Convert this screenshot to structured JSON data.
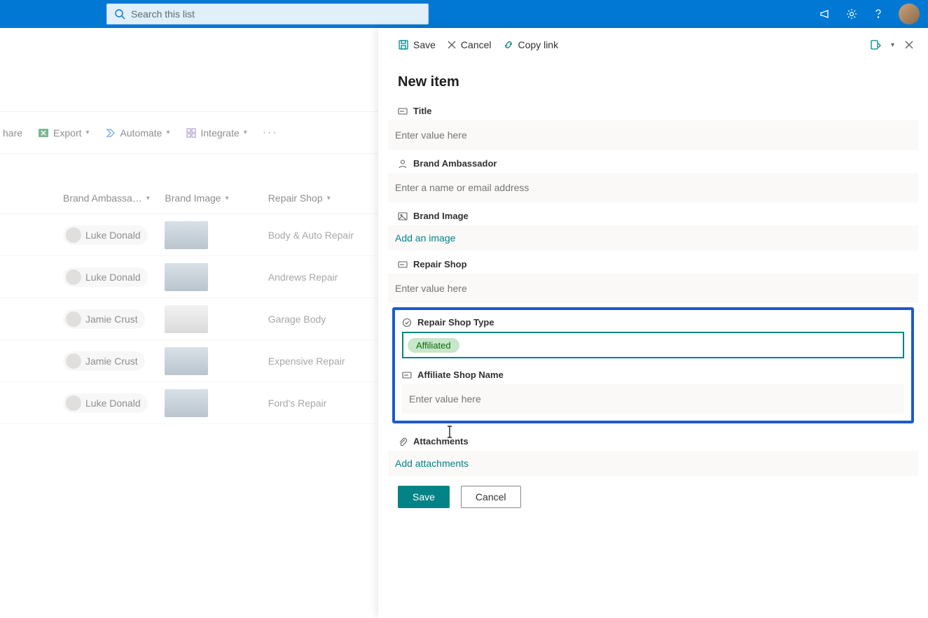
{
  "colors": {
    "accent": "#0078d4",
    "teal": "#038387",
    "highlight": "#1a5cc8"
  },
  "topbar": {
    "search_placeholder": "Search this list"
  },
  "commandbar": {
    "share": "hare",
    "export": "Export",
    "automate": "Automate",
    "integrate": "Integrate"
  },
  "columns": {
    "ambassador": "Brand Ambassa…",
    "image": "Brand Image",
    "shop": "Repair Shop"
  },
  "rows": [
    {
      "ambassador": "Luke Donald",
      "shop": "Body & Auto Repair"
    },
    {
      "ambassador": "Luke Donald",
      "shop": "Andrews Repair"
    },
    {
      "ambassador": "Jamie Crust",
      "shop": "Garage Body"
    },
    {
      "ambassador": "Jamie Crust",
      "shop": "Expensive Repair"
    },
    {
      "ambassador": "Luke Donald",
      "shop": "Ford's Repair"
    }
  ],
  "panel": {
    "cmd": {
      "save": "Save",
      "cancel": "Cancel",
      "copylink": "Copy link"
    },
    "title": "New item",
    "fields": {
      "title": {
        "label": "Title",
        "placeholder": "Enter value here"
      },
      "ambassador": {
        "label": "Brand Ambassador",
        "placeholder": "Enter a name or email address"
      },
      "image": {
        "label": "Brand Image",
        "link": "Add an image"
      },
      "shop": {
        "label": "Repair Shop",
        "placeholder": "Enter value here"
      },
      "shoptype": {
        "label": "Repair Shop Type",
        "value": "Affiliated"
      },
      "affiliate": {
        "label": "Affiliate Shop Name",
        "placeholder": "Enter value here"
      },
      "attachments": {
        "label": "Attachments",
        "link": "Add attachments"
      }
    },
    "buttons": {
      "save": "Save",
      "cancel": "Cancel"
    }
  }
}
